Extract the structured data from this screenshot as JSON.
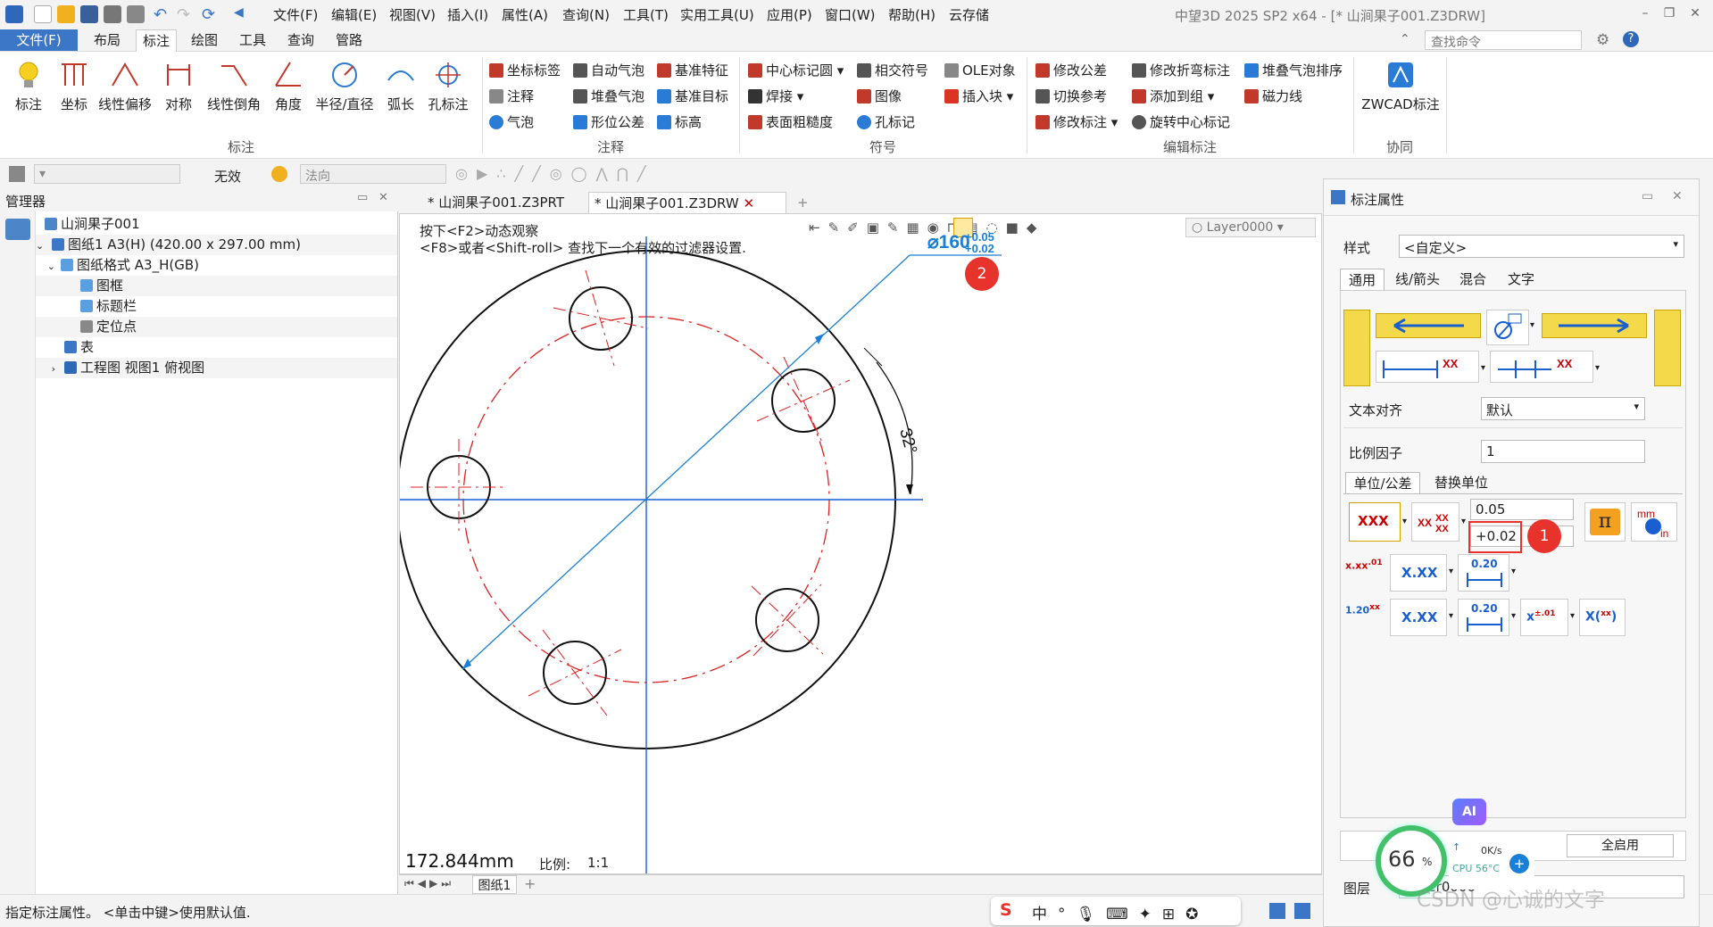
{
  "window": {
    "title": "中望3D 2025 SP2 x64 - [* 山涧果子001.Z3DRW]"
  },
  "menubar": [
    "文件(F)",
    "编辑(E)",
    "视图(V)",
    "插入(I)",
    "属性(A)",
    "查询(N)",
    "工具(T)",
    "实用工具(U)",
    "应用(P)",
    "窗口(W)",
    "帮助(H)",
    "云存储"
  ],
  "ribbon_tabs": {
    "file": "文件(F)",
    "tabs": [
      "布局",
      "标注",
      "绘图",
      "工具",
      "查询",
      "管路"
    ],
    "active": "标注"
  },
  "command_search": {
    "placeholder": "查找命令"
  },
  "ribbon": {
    "big_buttons": [
      "标注",
      "坐标",
      "线性偏移",
      "对称",
      "线性倒角",
      "角度",
      "半径/直径",
      "弧长",
      "孔标注"
    ],
    "group_dim": "标注",
    "annot_col1": [
      "坐标标签",
      "注释",
      "气泡"
    ],
    "annot_col2": [
      "自动气泡",
      "堆叠气泡",
      "形位公差"
    ],
    "annot_col3": [
      "基准特征",
      "基准目标",
      "标高"
    ],
    "group_annot": "注释",
    "sym_col1": [
      "中心标记圆",
      "焊接",
      "表面粗糙度"
    ],
    "sym_col2": [
      "相交符号",
      "图像",
      "孔标记"
    ],
    "sym_col3": [
      "OLE对象",
      "插入块"
    ],
    "group_sym": "符号",
    "edit_col1": [
      "修改公差",
      "切换参考",
      "修改标注"
    ],
    "edit_col2": [
      "修改折弯标注",
      "添加到组",
      "旋转中心标记"
    ],
    "edit_col3": [
      "堆叠气泡排序",
      "磁力线"
    ],
    "group_edit": "编辑标注",
    "zwcad": "ZWCAD标注",
    "group_collab": "协同"
  },
  "filterbar": {
    "invalid": "无效",
    "normal": "法向"
  },
  "manager": {
    "title": "管理器",
    "tree": [
      {
        "label": "山涧果子001",
        "indent": 0
      },
      {
        "label": "图纸1 A3(H) (420.00 x 297.00 mm)",
        "indent": 1
      },
      {
        "label": "图纸格式 A3_H(GB)",
        "indent": 2
      },
      {
        "label": "图框",
        "indent": 3
      },
      {
        "label": "标题栏",
        "indent": 3
      },
      {
        "label": "定位点",
        "indent": 3
      },
      {
        "label": "表",
        "indent": 2
      },
      {
        "label": "工程图 视图1 俯视图",
        "indent": 2
      }
    ]
  },
  "doc_tabs": [
    "* 山涧果子001.Z3PRT",
    "* 山涧果子001.Z3DRW"
  ],
  "canvas": {
    "hint1": "按下<F2>动态观察",
    "hint2": "<F8>或者<Shift-roll> 查找下一个有效的过滤器设置.",
    "layer": "Layer0000",
    "dim_main": "⌀160",
    "tol_upper": "+0.05",
    "tol_lower": "+0.02",
    "angle": "32°",
    "length_readout": "172.844mm",
    "scale_label": "比例:",
    "scale_value": "1:1",
    "badge2": "2"
  },
  "sheet_tab": "图纸1",
  "status": {
    "text": "指定标注属性。 <单击中键>使用默认值."
  },
  "props": {
    "title": "标注属性",
    "style_label": "样式",
    "style_value": "<自定义>",
    "tabs": [
      "通用",
      "线/箭头",
      "混合",
      "文字"
    ],
    "text_align_label": "文本对齐",
    "text_align_value": "默认",
    "scale_label": "比例因子",
    "scale_value": "1",
    "unit_tabs": [
      "单位/公差",
      "替换单位"
    ],
    "upper_tol": "0.05",
    "lower_tol": "+0.02",
    "badge1": "1",
    "fmt_xxx": "XXX",
    "fmt_xdotxx": "X.XX",
    "fmt_020": "0.20",
    "ai": "AI",
    "enable_all": "全启用",
    "layer_label": "图层",
    "layer_value": "Layer0000"
  },
  "widgets": {
    "cpu_percent": "66",
    "net": "0K/s",
    "cpu_temp": "CPU 56°C",
    "watermark": "CSDN @心诚的文字"
  },
  "colors": {
    "accent": "#3c76c6",
    "badge": "#e8322c",
    "dim_blue": "#1a7fd6",
    "red_center": "#e02020"
  }
}
